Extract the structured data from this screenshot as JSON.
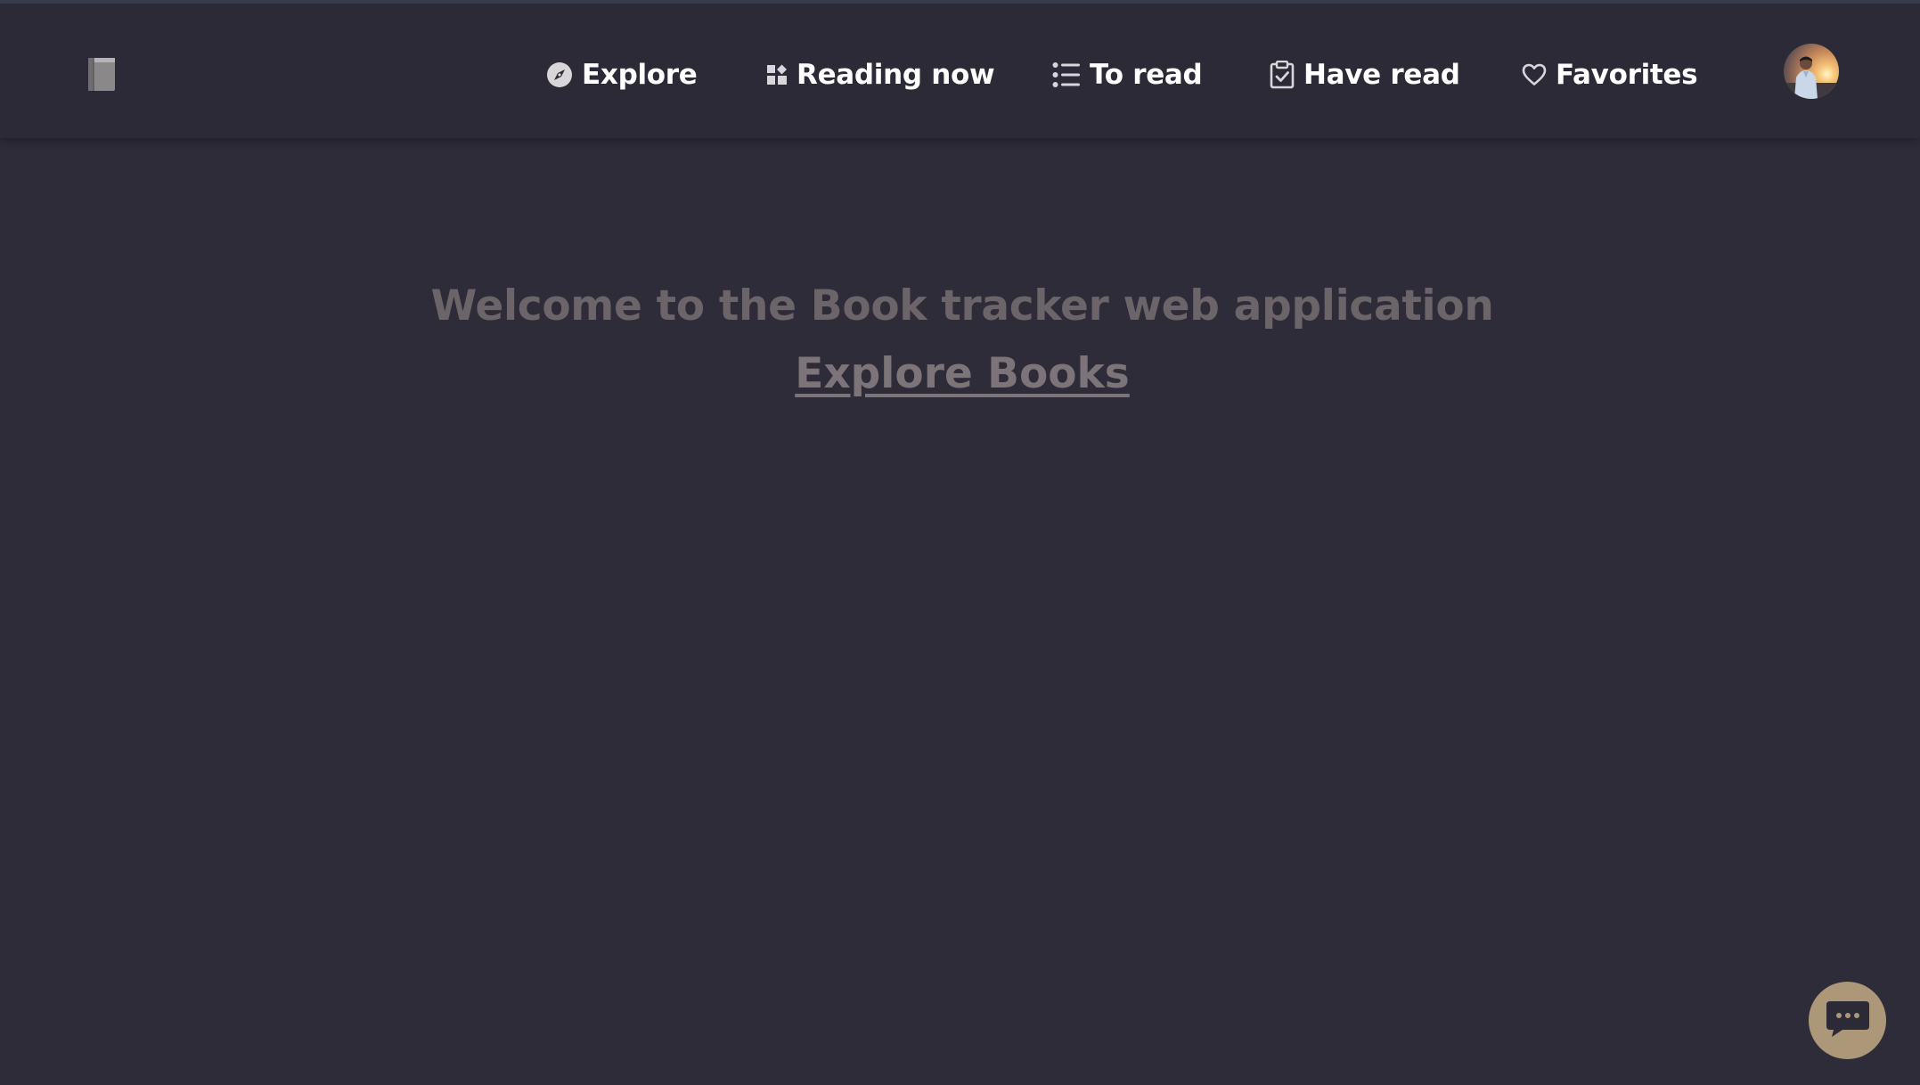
{
  "app": {
    "logo_icon": "book-icon"
  },
  "nav": {
    "items": [
      {
        "label": "Explore",
        "icon": "compass-icon"
      },
      {
        "label": "Reading now",
        "icon": "dashboard-icon"
      },
      {
        "label": "To read",
        "icon": "list-icon"
      },
      {
        "label": "Have read",
        "icon": "clipboard-check-icon"
      },
      {
        "label": "Favorites",
        "icon": "heart-icon"
      }
    ],
    "avatar_icon": "user-avatar"
  },
  "hero": {
    "title": "Welcome to the Book tracker web application",
    "link_label": "Explore Books"
  },
  "chat": {
    "icon": "chat-bubble-icon"
  },
  "colors": {
    "background": "#2e2c38",
    "navbar": "#2c2a36",
    "nav_text": "#ffffff",
    "hero_title": "#6b6468",
    "hero_link": "#7d7479",
    "chat_button": "#ac9879"
  }
}
